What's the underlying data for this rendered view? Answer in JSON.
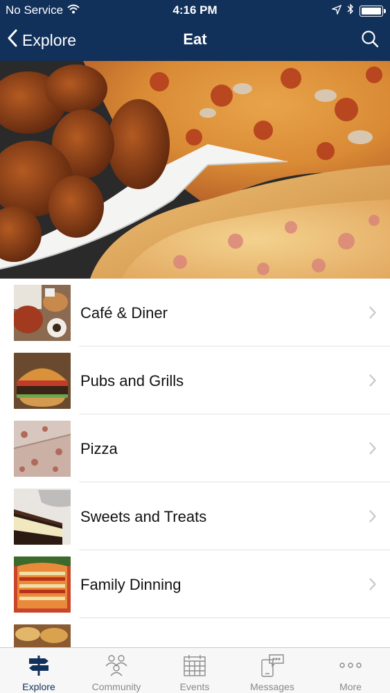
{
  "status_bar": {
    "carrier": "No Service",
    "time": "4:16 PM"
  },
  "navbar": {
    "back_label": "Explore",
    "title": "Eat"
  },
  "colors": {
    "header_bg": "#11305a",
    "tab_active": "#11305a",
    "tab_inactive": "#8a8a8a"
  },
  "categories": [
    {
      "label": "Café & Diner",
      "thumb": "cafe-diner-photo"
    },
    {
      "label": "Pubs and Grills",
      "thumb": "burger-photo"
    },
    {
      "label": "Pizza",
      "thumb": "pizza-slice-photo"
    },
    {
      "label": "Sweets and Treats",
      "thumb": "cake-slice-photo"
    },
    {
      "label": "Family Dinning",
      "thumb": "lasagna-photo"
    }
  ],
  "tabs": [
    {
      "label": "Explore",
      "icon": "signpost-icon",
      "active": true
    },
    {
      "label": "Community",
      "icon": "people-icon",
      "active": false
    },
    {
      "label": "Events",
      "icon": "calendar-icon",
      "active": false
    },
    {
      "label": "Messages",
      "icon": "phone-chat-icon",
      "active": false
    },
    {
      "label": "More",
      "icon": "more-dots-icon",
      "active": false
    }
  ]
}
